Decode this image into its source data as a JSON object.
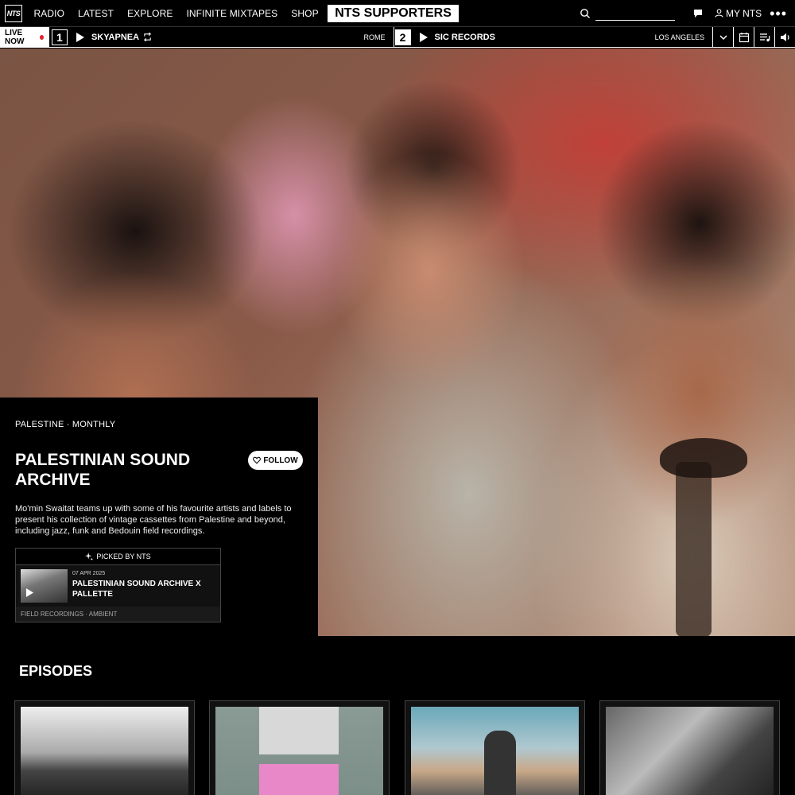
{
  "nav": {
    "logo": "NTS",
    "items": [
      "RADIO",
      "LATEST",
      "EXPLORE",
      "INFINITE MIXTAPES",
      "SHOP"
    ],
    "supporters": "NTS SUPPORTERS",
    "search_placeholder": "",
    "my_nts": "MY NTS"
  },
  "player": {
    "live_now": "LIVE NOW",
    "channel1": {
      "number": "1",
      "show": "SKYAPNEA",
      "location": "ROME"
    },
    "channel2": {
      "number": "2",
      "show": "SIC RECORDS",
      "location": "LOS ANGELES"
    }
  },
  "show": {
    "tags": "PALESTINE · MONTHLY",
    "title": "PALESTINIAN SOUND ARCHIVE",
    "follow": "FOLLOW",
    "description": "Mo'min Swaitat teams up with some of his favourite artists and labels to present his collection of vintage cassettes from Palestine and beyond, including jazz, funk and Bedouin field recordings.",
    "picked": {
      "label": "PICKED BY NTS",
      "date": "07 APR 2025",
      "title": "PALESTINIAN SOUND ARCHIVE X PALLETTE",
      "genres": "FIELD RECORDINGS · AMBIENT"
    }
  },
  "episodes": {
    "heading": "EPISODES"
  },
  "colors": {
    "live_dot": "#e0242b",
    "background": "#000000"
  }
}
